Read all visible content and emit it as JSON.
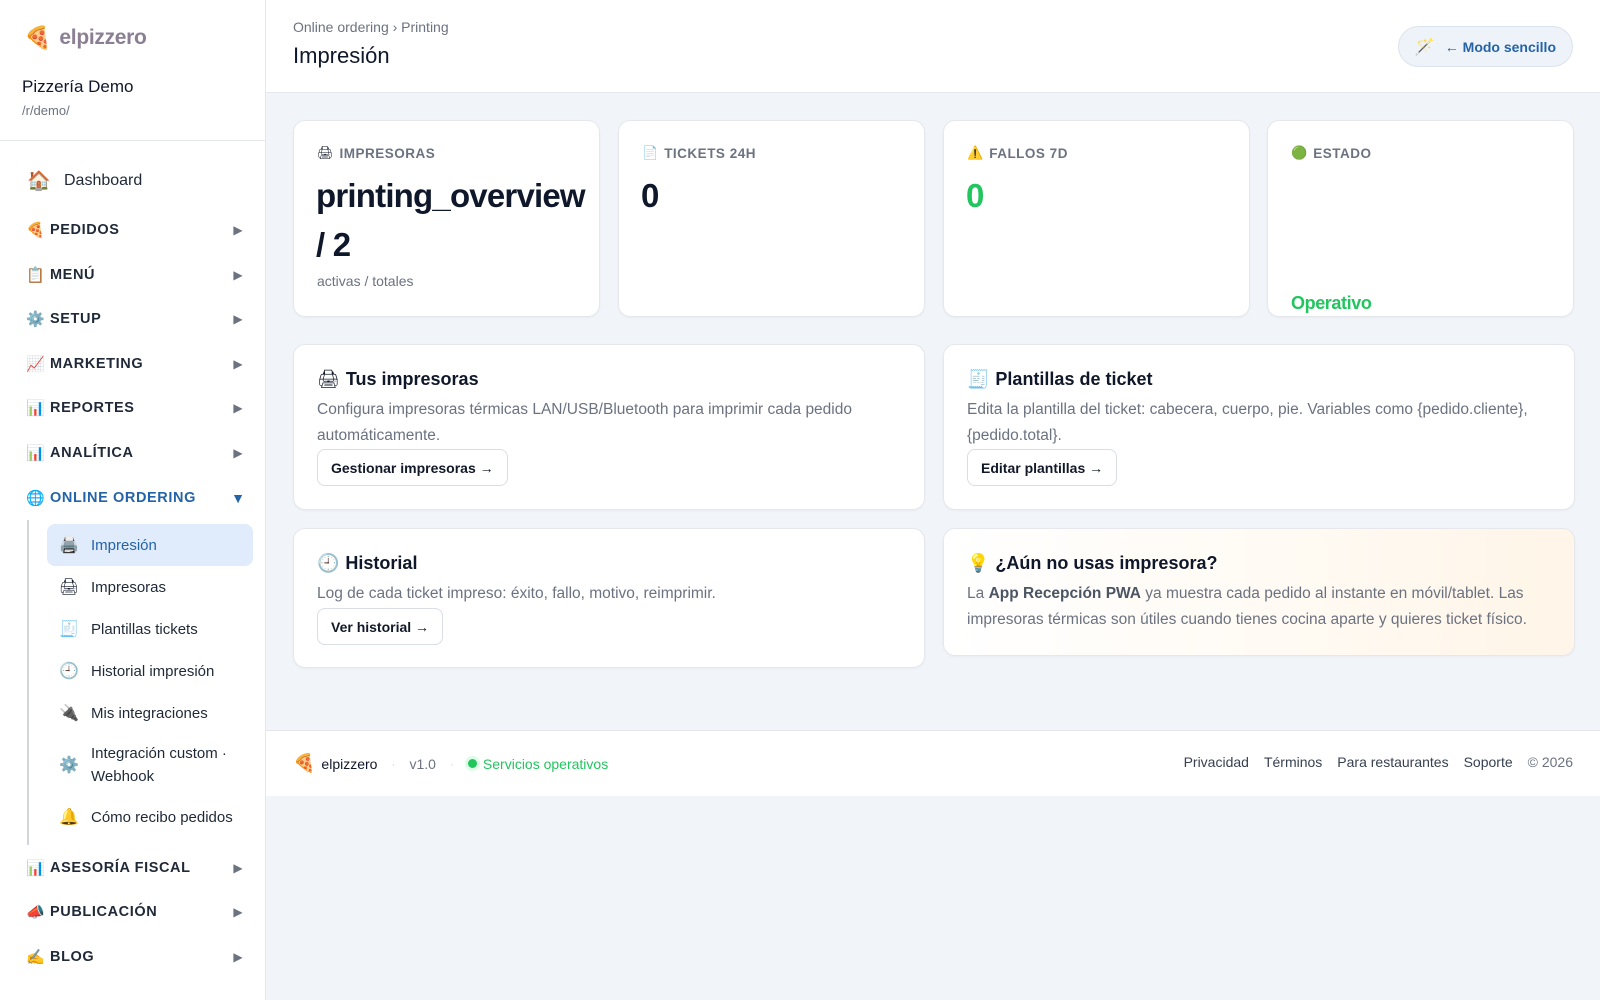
{
  "brand": {
    "logo_icon": "pizza-icon",
    "logo_glyph": "🍕",
    "name": "elpizzero",
    "color": "#8b7f93"
  },
  "restaurant": {
    "name": "Pizzería Demo",
    "path": "/r/demo/"
  },
  "sidebar": {
    "dashboard": {
      "icon": "house-icon",
      "glyph": "🏠",
      "label": "Dashboard"
    },
    "sections": [
      {
        "icon": "pizza-icon",
        "glyph": "🍕",
        "label": "PEDIDOS",
        "arrow": "▶"
      },
      {
        "icon": "clipboard-icon",
        "glyph": "📋",
        "label": "MENÚ",
        "arrow": "▶"
      },
      {
        "icon": "gear-icon",
        "glyph": "⚙️",
        "label": "SETUP",
        "arrow": "▶"
      },
      {
        "icon": "trend-chart-icon",
        "glyph": "📈",
        "label": "MARKETING",
        "arrow": "▶"
      },
      {
        "icon": "bar-chart-icon",
        "glyph": "📊",
        "label": "REPORTES",
        "arrow": "▶"
      },
      {
        "icon": "bar-chart-icon",
        "glyph": "📊",
        "label": "ANALÍTICA",
        "arrow": "▶"
      },
      {
        "icon": "globe-icon",
        "glyph": "🌐",
        "label": "ONLINE ORDERING",
        "arrow": "▼"
      },
      {
        "icon": "bar-chart-icon",
        "glyph": "📊",
        "label": "ASESORÍA FISCAL",
        "arrow": "▶"
      },
      {
        "icon": "megaphone-icon",
        "glyph": "📣",
        "label": "PUBLICACIÓN",
        "arrow": "▶"
      },
      {
        "icon": "writing-hand-icon",
        "glyph": "✍️",
        "label": "BLOG",
        "arrow": "▶"
      }
    ],
    "online_ordering_items": [
      {
        "icon": "printer-icon",
        "glyph": "🖨️",
        "label": "Impresión",
        "active": true
      },
      {
        "icon": "printer-icon",
        "glyph": "🖨",
        "label": "Impresoras"
      },
      {
        "icon": "receipt-icon",
        "glyph": "🧾",
        "label": "Plantillas tickets"
      },
      {
        "icon": "clock-icon",
        "glyph": "🕘",
        "label": "Historial impresión"
      },
      {
        "icon": "plug-icon",
        "glyph": "🔌",
        "label": "Mis integraciones"
      },
      {
        "icon": "gear-icon",
        "glyph": "⚙️",
        "label": "Integración custom · Webhook"
      },
      {
        "icon": "bell-icon",
        "glyph": "🔔",
        "label": "Cómo recibo pedidos"
      }
    ]
  },
  "header": {
    "breadcrumb": "Online ordering › Printing",
    "title": "Impresión",
    "mode_button": {
      "icon": "magic-wand-icon",
      "glyph": "🪄",
      "label": "← Modo sencillo"
    }
  },
  "stats": [
    {
      "icon": "printer-icon",
      "glyph": "🖨",
      "label": "IMPRESORAS",
      "value": "printing_overview / 2",
      "sub": "activas / totales"
    },
    {
      "icon": "page-icon",
      "glyph": "📄",
      "label": "TICKETS 24H",
      "value": "0"
    },
    {
      "icon": "warning-icon",
      "glyph": "⚠️",
      "label": "FALLOS 7D",
      "value": "0"
    },
    {
      "icon": "green-circle-icon",
      "glyph": "🟢",
      "label": "ESTADO",
      "value": "Operativo"
    }
  ],
  "cards": {
    "printers": {
      "icon": "printer-icon",
      "glyph": "🖨",
      "title": "Tus impresoras",
      "desc": "Configura impresoras térmicas LAN/USB/Bluetooth para imprimir cada pedido automáticamente.",
      "button": "Gestionar impresoras →"
    },
    "templates": {
      "icon": "receipt-icon",
      "glyph": "🧾",
      "title": "Plantillas de ticket",
      "desc": "Edita la plantilla del ticket: cabecera, cuerpo, pie. Variables como {pedido.cliente}, {pedido.total}.",
      "button": "Editar plantillas →"
    },
    "history": {
      "icon": "clock-icon",
      "glyph": "🕘",
      "title": "Historial",
      "desc": "Log de cada ticket impreso: éxito, fallo, motivo, reimprimir.",
      "button": "Ver historial →"
    },
    "tip": {
      "icon": "lightbulb-icon",
      "glyph": "💡",
      "title": "¿Aún no usas impresora?",
      "desc_before": "La ",
      "desc_bold": "App Recepción PWA",
      "desc_after": " ya muestra cada pedido al instante en móvil/tablet. Las impresoras térmicas son útiles cuando tienes cocina aparte y quieres ticket físico."
    }
  },
  "footer": {
    "logo_glyph": "🍕",
    "brand": "elpizzero",
    "version": "v1.0",
    "status": "Servicios operativos",
    "links": [
      "Privacidad",
      "Términos",
      "Para restaurantes",
      "Soporte"
    ],
    "copyright": "© 2026"
  },
  "colors": {
    "accent": "#2563a8",
    "success": "#22c55e",
    "background": "#f1f5f9",
    "active_bg": "#e0ecfb"
  }
}
